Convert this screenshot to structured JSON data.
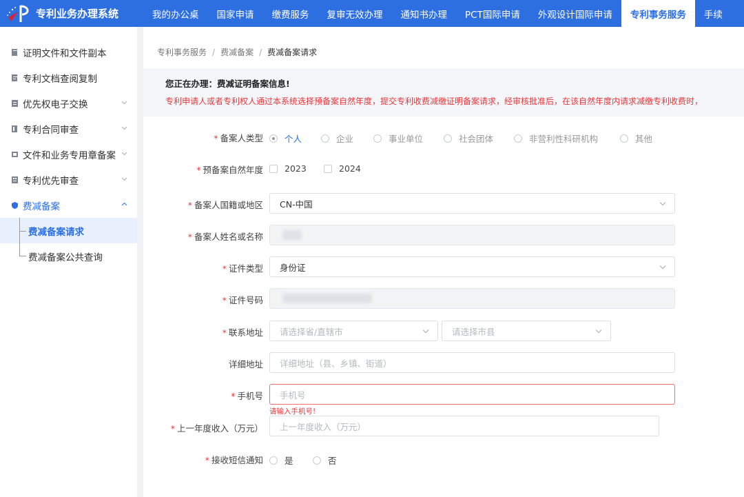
{
  "header": {
    "system_title": "专利业务办理系统",
    "nav": [
      {
        "label": "我的办公桌"
      },
      {
        "label": "国家申请"
      },
      {
        "label": "缴费服务"
      },
      {
        "label": "复审无效办理"
      },
      {
        "label": "通知书办理"
      },
      {
        "label": "PCT国际申请"
      },
      {
        "label": "外观设计国际申请"
      },
      {
        "label": "专利事务服务",
        "active": true
      },
      {
        "label": "手续"
      }
    ]
  },
  "sidebar": {
    "items": [
      {
        "label": "证明文件和文件副本",
        "icon": "document-stack-icon"
      },
      {
        "label": "专利文档查阅复制",
        "icon": "document-copy-icon"
      },
      {
        "label": "优先权电子交换",
        "icon": "exchange-icon",
        "expandable": true
      },
      {
        "label": "专利合同审查",
        "icon": "contract-icon",
        "expandable": true
      },
      {
        "label": "文件和业务专用章备案",
        "icon": "seal-icon",
        "expandable": true
      },
      {
        "label": "专利优先审查",
        "icon": "priority-icon",
        "expandable": true
      },
      {
        "label": "费减备案",
        "icon": "shield-icon",
        "expanded": true
      }
    ],
    "subitems": [
      {
        "label": "费减备案请求",
        "active": true
      },
      {
        "label": "费减备案公共查询"
      }
    ]
  },
  "breadcrumb": [
    "专利事务服务",
    "费减备案",
    "费减备案请求"
  ],
  "notice": {
    "title": "您正在办理：费减证明备案信息!",
    "text": "专利申请人或者专利权人通过本系统选择预备案自然年度，提交专利收费减缴证明备案请求，经审核批准后，在该自然年度内请求减缴专利收费时，"
  },
  "form": {
    "filer_type": {
      "label": "备案人类型",
      "required": true,
      "options": [
        "个人",
        "企业",
        "事业单位",
        "社会团体",
        "非营利性科研机构",
        "其他"
      ],
      "selected": "个人"
    },
    "year": {
      "label": "预备案自然年度",
      "required": true,
      "options": [
        "2023",
        "2024"
      ]
    },
    "region": {
      "label": "备案人国籍或地区",
      "required": true,
      "value": "CN-中国"
    },
    "name": {
      "label": "备案人姓名或名称",
      "required": true,
      "value": ""
    },
    "id_type": {
      "label": "证件类型",
      "required": true,
      "value": "身份证"
    },
    "id_number": {
      "label": "证件号码",
      "required": true,
      "value": ""
    },
    "address": {
      "label": "联系地址",
      "required": true,
      "province_placeholder": "请选择省/直辖市",
      "city_placeholder": "请选择市县"
    },
    "detail_address": {
      "label": "详细地址",
      "required": false,
      "placeholder": "详细地址（县、乡镇、街道）"
    },
    "phone": {
      "label": "手机号",
      "required": true,
      "placeholder": "手机号",
      "error": "请输入手机号!"
    },
    "income": {
      "label": "上一年度收入（万元）",
      "required": true,
      "placeholder": "上一年度收入（万元）"
    },
    "sms": {
      "label": "接收短信通知",
      "required": true,
      "options": [
        "是",
        "否"
      ]
    }
  },
  "colors": {
    "primary": "#2d6fe0",
    "error": "#e4393c",
    "logo_red": "#d9232e"
  }
}
